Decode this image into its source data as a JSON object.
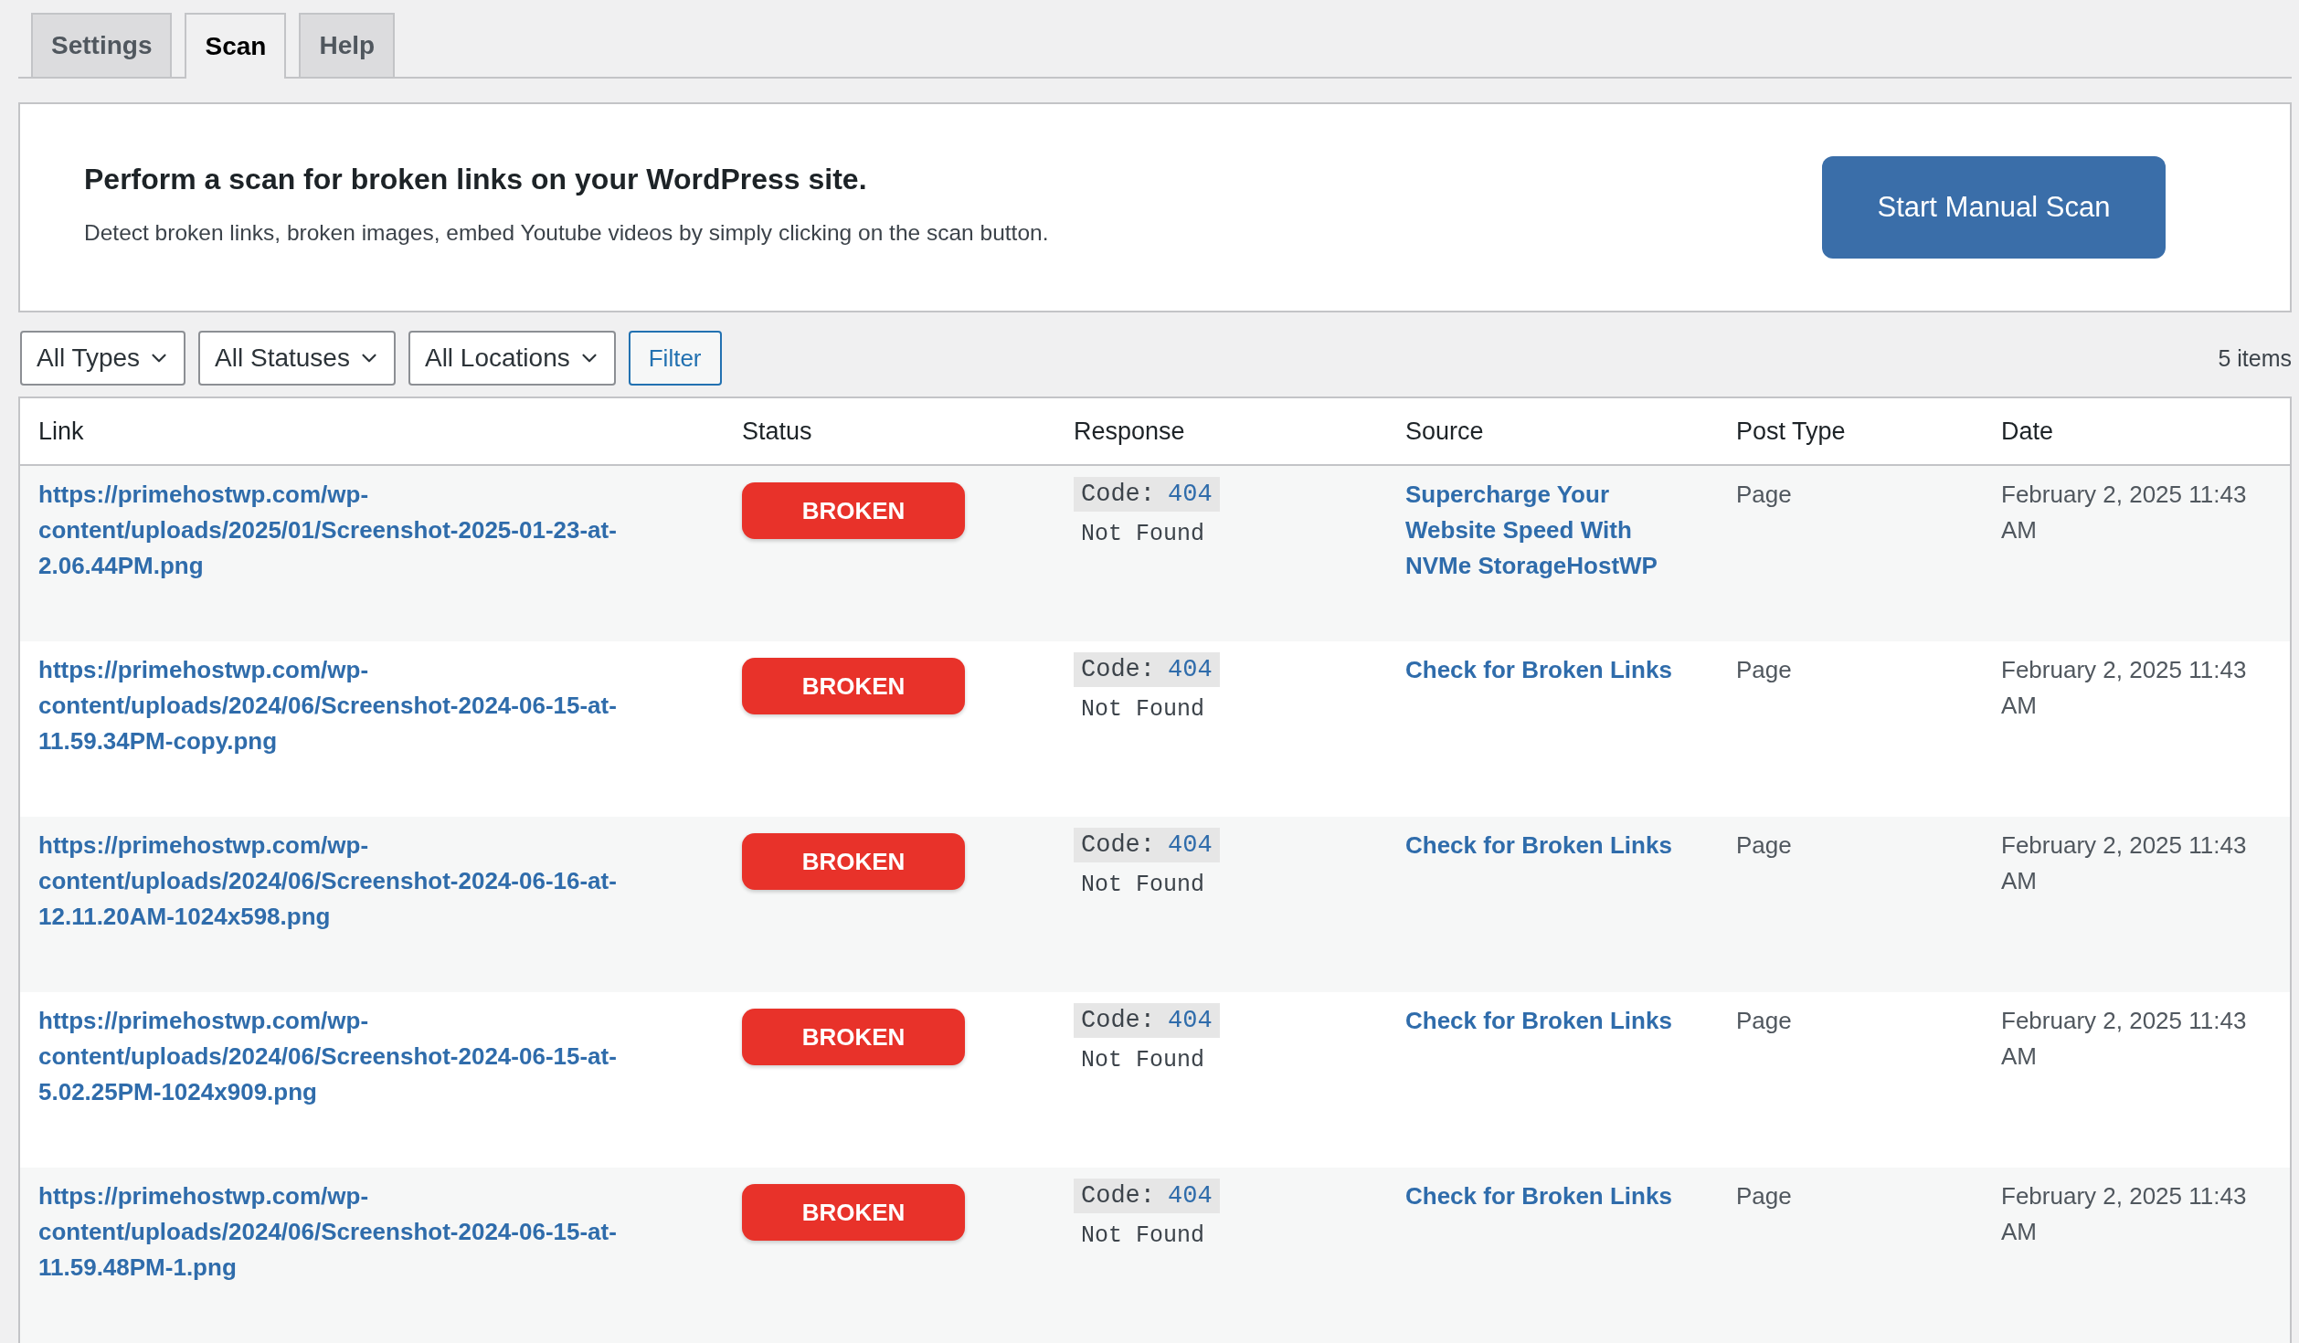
{
  "tabs": [
    {
      "label": "Settings",
      "selected": false
    },
    {
      "label": "Scan",
      "selected": true
    },
    {
      "label": "Help",
      "selected": false
    }
  ],
  "scan_card": {
    "title": "Perform a scan for broken links on your WordPress site.",
    "description": "Detect broken links, broken images, embed Youtube videos by simply clicking on the scan button.",
    "button": "Start Manual Scan"
  },
  "filters": {
    "dropdowns": [
      "All Types",
      "All Statuses",
      "All Locations"
    ],
    "button": "Filter",
    "count": "5 items"
  },
  "table": {
    "columns": [
      "Link",
      "Status",
      "Response",
      "Source",
      "Post Type",
      "Date"
    ],
    "rows": [
      {
        "link": "https://primehostwp.com/wp-content/uploads/2025/01/Screenshot-2025-01-23-at-2.06.44PM.png",
        "status": "BROKEN",
        "code_label": "Code:",
        "code": "404",
        "message": "Not Found",
        "source": "Supercharge Your Website Speed With NVMe StorageHostWP",
        "post_type": "Page",
        "date": "February 2, 2025 11:43 AM"
      },
      {
        "link": "https://primehostwp.com/wp-content/uploads/2024/06/Screenshot-2024-06-15-at-11.59.34PM-copy.png",
        "status": "BROKEN",
        "code_label": "Code:",
        "code": "404",
        "message": "Not Found",
        "source": "Check for Broken Links",
        "post_type": "Page",
        "date": "February 2, 2025 11:43 AM"
      },
      {
        "link": "https://primehostwp.com/wp-content/uploads/2024/06/Screenshot-2024-06-16-at-12.11.20AM-1024x598.png",
        "status": "BROKEN",
        "code_label": "Code:",
        "code": "404",
        "message": "Not Found",
        "source": "Check for Broken Links",
        "post_type": "Page",
        "date": "February 2, 2025 11:43 AM"
      },
      {
        "link": "https://primehostwp.com/wp-content/uploads/2024/06/Screenshot-2024-06-15-at-5.02.25PM-1024x909.png",
        "status": "BROKEN",
        "code_label": "Code:",
        "code": "404",
        "message": "Not Found",
        "source": "Check for Broken Links",
        "post_type": "Page",
        "date": "February 2, 2025 11:43 AM"
      },
      {
        "link": "https://primehostwp.com/wp-content/uploads/2024/06/Screenshot-2024-06-15-at-11.59.48PM-1.png",
        "status": "BROKEN",
        "code_label": "Code:",
        "code": "404",
        "message": "Not Found",
        "source": "Check for Broken Links",
        "post_type": "Page",
        "date": "February 2, 2025 11:43 AM"
      }
    ]
  }
}
